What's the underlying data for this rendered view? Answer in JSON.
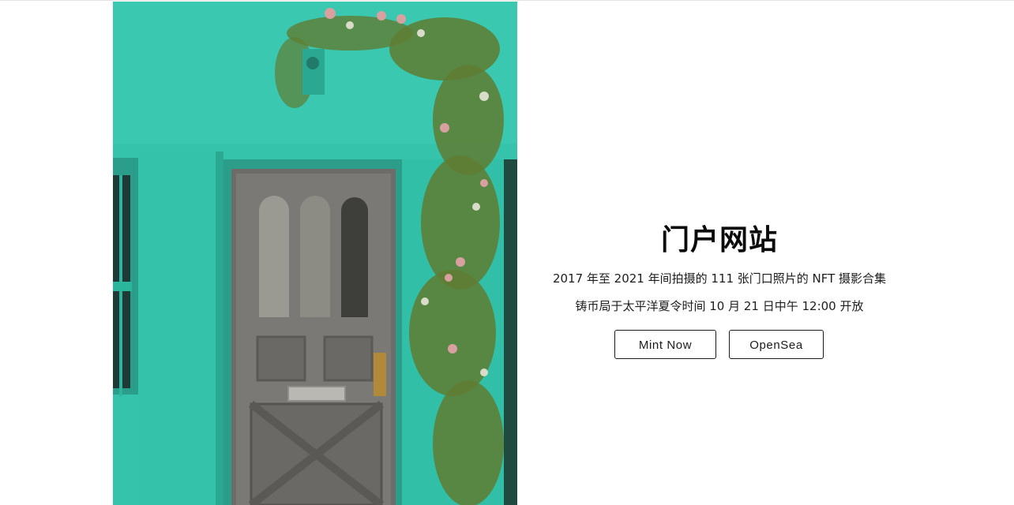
{
  "hero": {
    "image_description_icon": "door-photo"
  },
  "main": {
    "title": "门户网站",
    "description": "2017 年至 2021 年间拍摄的 111 张门口照片的 NFT 摄影合集",
    "mint_info": "铸币局于太平洋夏令时间 10 月 21 日中午 12:00 开放",
    "buttons": {
      "mint_label": "Mint Now",
      "opensea_label": "OpenSea"
    }
  },
  "colors": {
    "wall": "#2fbfa6",
    "door": "#6b6b68",
    "text": "#0b0b0b",
    "button_border": "#1b1b1b",
    "background": "#ffffff"
  }
}
